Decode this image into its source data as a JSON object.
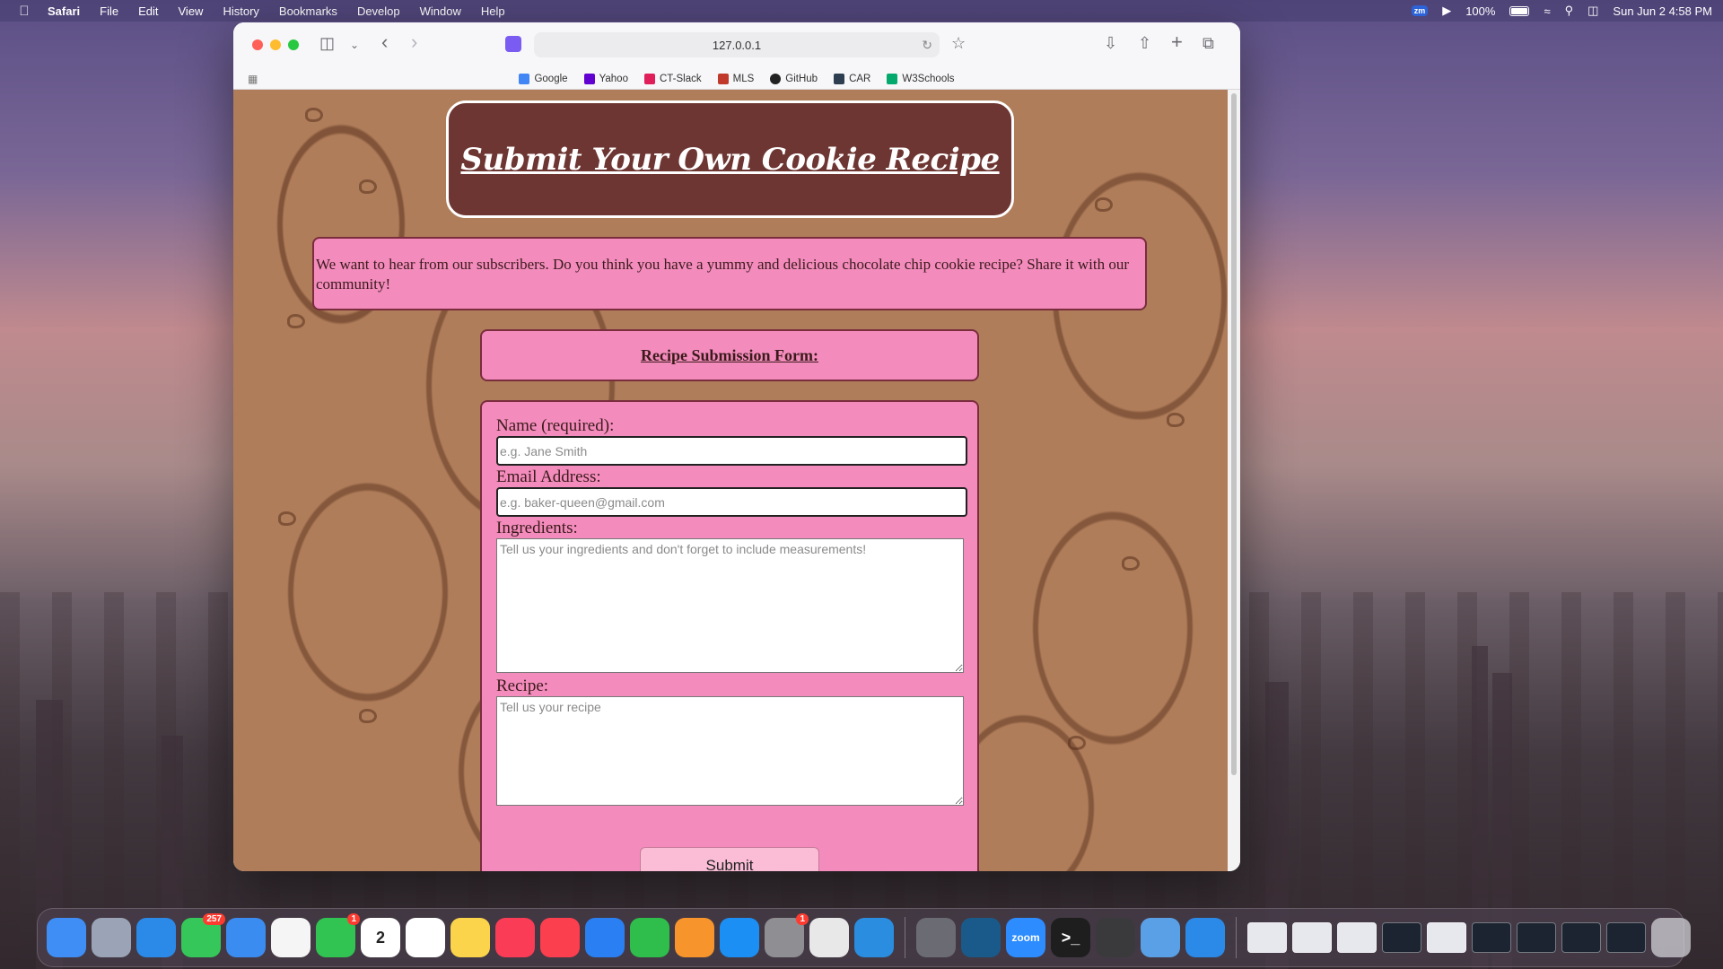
{
  "menubar": {
    "app": "Safari",
    "items": [
      "File",
      "Edit",
      "View",
      "History",
      "Bookmarks",
      "Develop",
      "Window",
      "Help"
    ],
    "zoom_badge": "zm",
    "battery": "100%",
    "datetime": "Sun Jun 2  4:58 PM"
  },
  "browser": {
    "url": "127.0.0.1",
    "bookmarks": [
      {
        "label": "Google",
        "icon": "google-icon",
        "color": "#4285f4"
      },
      {
        "label": "Yahoo",
        "icon": "yahoo-icon",
        "color": "#6001d2"
      },
      {
        "label": "CT-Slack",
        "icon": "slack-icon",
        "color": "#e01e5a"
      },
      {
        "label": "MLS",
        "icon": "mls-icon",
        "color": "#c0392b"
      },
      {
        "label": "GitHub",
        "icon": "github-icon",
        "color": "#222222"
      },
      {
        "label": "CAR",
        "icon": "car-icon",
        "color": "#2c3e50"
      },
      {
        "label": "W3Schools",
        "icon": "w3schools-icon",
        "color": "#04aa6d"
      }
    ]
  },
  "page": {
    "title": "Submit Your Own Cookie Recipe",
    "intro": "We want to hear from our subscribers. Do you think you have a yummy and delicious chocolate chip cookie recipe? Share it with our community!",
    "form_heading": "Recipe Submission Form:",
    "form": {
      "name_label": "Name (required):",
      "name_placeholder": "e.g. Jane Smith",
      "email_label": "Email Address:",
      "email_placeholder": "e.g. baker-queen@gmail.com",
      "ingredients_label": "Ingredients:",
      "ingredients_placeholder": "Tell us your ingredients and don't forget to include measurements!",
      "recipe_label": "Recipe:",
      "recipe_placeholder": "Tell us your recipe",
      "submit_label": "Submit"
    }
  },
  "colors": {
    "hero_bg": "#6e3632",
    "panel_pink": "#f38cbd",
    "page_bg": "#b07d5a",
    "submit_bg": "#fbbdd6"
  },
  "dock": {
    "apps": [
      {
        "name": "finder-icon",
        "color": "#3f8ef5"
      },
      {
        "name": "launchpad-icon",
        "color": "#9aa4b6"
      },
      {
        "name": "safari-icon",
        "color": "#2b8ae8"
      },
      {
        "name": "messages-icon",
        "color": "#35c759",
        "badge": "257"
      },
      {
        "name": "mail-icon",
        "color": "#3b8cf0"
      },
      {
        "name": "photos-icon",
        "color": "#f5f5f5"
      },
      {
        "name": "facetime-icon",
        "color": "#31c452",
        "badge": "1"
      },
      {
        "name": "calendar-icon",
        "color": "#ffffff",
        "text": "2"
      },
      {
        "name": "reminders-icon",
        "color": "#ffffff"
      },
      {
        "name": "notes-icon",
        "color": "#fbd44b"
      },
      {
        "name": "music-icon",
        "color": "#fa3c56"
      },
      {
        "name": "news-icon",
        "color": "#fb3f4f"
      },
      {
        "name": "keynote-icon",
        "color": "#2a7ff2"
      },
      {
        "name": "numbers-icon",
        "color": "#2fbe4b"
      },
      {
        "name": "pages-icon",
        "color": "#f7952c"
      },
      {
        "name": "app-store-icon",
        "color": "#1c8ff5"
      },
      {
        "name": "system-settings-icon",
        "color": "#8e8e93",
        "badge": "1"
      },
      {
        "name": "chrome-icon",
        "color": "#e8e8e8"
      },
      {
        "name": "vscode-icon",
        "color": "#2a8ddf"
      },
      {
        "name": "rocket-icon",
        "color": "#6b6b73"
      },
      {
        "name": "mysql-workbench-icon",
        "color": "#1a5a8a"
      },
      {
        "name": "zoom-icon",
        "color": "#2d8cff",
        "text": "zoom"
      },
      {
        "name": "terminal-icon",
        "color": "#1e1e1e",
        "text": ">_"
      },
      {
        "name": "calculator-icon",
        "color": "#3a3a3c"
      },
      {
        "name": "preview-icon",
        "color": "#5aa0e6"
      },
      {
        "name": "safari-dev-icon",
        "color": "#2b8ae8"
      }
    ],
    "windows": [
      "light",
      "light",
      "light",
      "dark",
      "light",
      "dark",
      "dark",
      "dark",
      "dark"
    ],
    "trash": "trash-icon"
  }
}
